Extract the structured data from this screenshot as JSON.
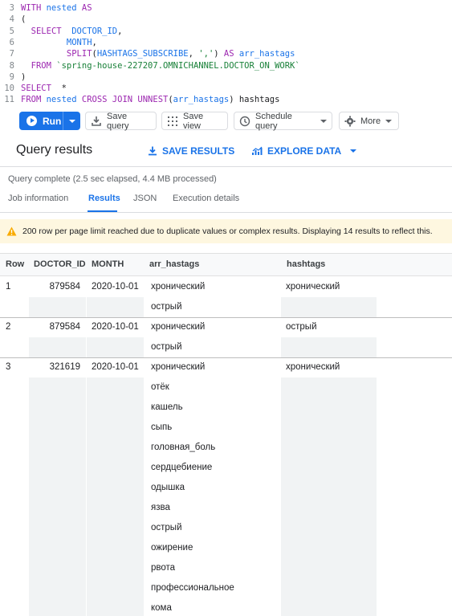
{
  "editor": {
    "lines": [
      {
        "n": "3",
        "parts": [
          [
            "kw",
            "WITH "
          ],
          [
            "fn",
            "nested "
          ],
          [
            "kw",
            "AS"
          ]
        ]
      },
      {
        "n": "4",
        "parts": [
          [
            "plain",
            "("
          ]
        ]
      },
      {
        "n": "5",
        "parts": [
          [
            "plain",
            "  "
          ],
          [
            "kw",
            "SELECT  "
          ],
          [
            "fn",
            "DOCTOR_ID"
          ],
          [
            "plain",
            ","
          ]
        ]
      },
      {
        "n": "6",
        "parts": [
          [
            "plain",
            "         "
          ],
          [
            "fn",
            "MONTH"
          ],
          [
            "plain",
            ","
          ]
        ]
      },
      {
        "n": "7",
        "parts": [
          [
            "plain",
            "         "
          ],
          [
            "kw",
            "SPLIT"
          ],
          [
            "plain",
            "("
          ],
          [
            "fn",
            "HASHTAGS_SUBSCRIBE"
          ],
          [
            "plain",
            ", "
          ],
          [
            "str",
            "','"
          ],
          [
            "plain",
            ") "
          ],
          [
            "kw",
            "AS "
          ],
          [
            "fn",
            "arr_hastags"
          ]
        ]
      },
      {
        "n": "8",
        "parts": [
          [
            "plain",
            "  "
          ],
          [
            "kw",
            "FROM "
          ],
          [
            "str",
            "`spring-house-227207.OMNICHANNEL.DOCTOR_ON_WORK`"
          ]
        ]
      },
      {
        "n": "9",
        "parts": [
          [
            "plain",
            ")"
          ]
        ]
      },
      {
        "n": "10",
        "parts": [
          [
            "kw",
            "SELECT  "
          ],
          [
            "plain",
            "*"
          ]
        ]
      },
      {
        "n": "11",
        "parts": [
          [
            "kw",
            "FROM "
          ],
          [
            "fn",
            "nested "
          ],
          [
            "kw",
            "CROSS JOIN UNNEST"
          ],
          [
            "plain",
            "("
          ],
          [
            "fn",
            "arr_hastags"
          ],
          [
            "plain",
            ") hashtags"
          ]
        ]
      }
    ]
  },
  "toolbar": {
    "run_label": "Run",
    "save_query_label": "Save query",
    "save_view_label": "Save view",
    "schedule_label": "Schedule query",
    "more_label": "More"
  },
  "results": {
    "title": "Query results",
    "save_results_label": "SAVE RESULTS",
    "explore_label": "EXPLORE DATA",
    "status": "Query complete (2.5 sec elapsed, 4.4 MB processed)",
    "tabs": [
      "Job information",
      "Results",
      "JSON",
      "Execution details"
    ],
    "warning": "200 row per page limit reached due to duplicate values or complex results. Displaying 14 results to reflect this."
  },
  "table": {
    "headers": [
      "Row",
      "DOCTOR_ID",
      "MONTH",
      "arr_hastags",
      "hashtags"
    ],
    "rows": [
      {
        "row": "1",
        "doctor_id": "879584",
        "month": "2020-10-01",
        "arr": [
          "хронический",
          "острый"
        ],
        "hashtag": "хронический"
      },
      {
        "row": "2",
        "doctor_id": "879584",
        "month": "2020-10-01",
        "arr": [
          "хронический",
          "острый"
        ],
        "hashtag": " острый"
      },
      {
        "row": "3",
        "doctor_id": "321619",
        "month": "2020-10-01",
        "arr": [
          "хронический",
          "отёк",
          "кашель",
          "сыпь",
          "головная_боль",
          "сердцебиение",
          "одышка",
          "язва",
          "острый",
          "ожирение",
          "рвота",
          "профессиональное",
          "кома"
        ],
        "hashtag": "хронический"
      }
    ]
  },
  "colors": {
    "accent": "#1a73e8",
    "warning_bg": "#fef7e0",
    "warning_icon": "#f9ab00"
  }
}
